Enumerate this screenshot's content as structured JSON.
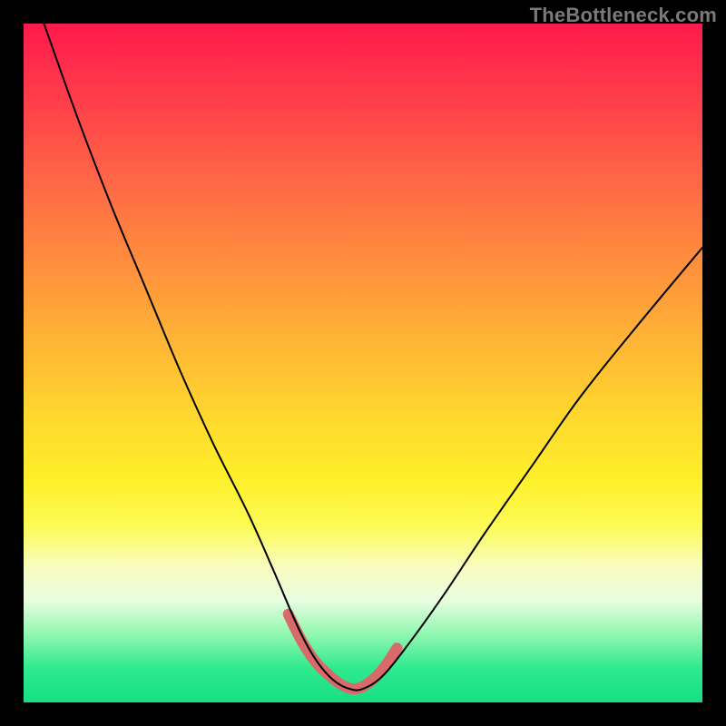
{
  "watermark": "TheBottleneck.com",
  "colors": {
    "gradient_top": "#ff1a4d",
    "gradient_mid": "#ffd82e",
    "gradient_bottom": "#16df84",
    "curve": "#000000",
    "highlight": "#d86a6a",
    "frame": "#000000"
  },
  "chart_data": {
    "type": "line",
    "title": "",
    "xlabel": "",
    "ylabel": "",
    "xlim": [
      0,
      100
    ],
    "ylim": [
      0,
      100
    ],
    "grid": false,
    "legend": false,
    "note": "Background is a vertical green→yellow→red gradient indicating bottleneck severity (green=good at bottom, red=bad at top). Single V-shaped curve overlaid; coral highlight marks the optimal (lowest) region of the curve.",
    "series": [
      {
        "name": "bottleneck-curve",
        "x": [
          3,
          8,
          13,
          18,
          23,
          28,
          33,
          37,
          40,
          42,
          44,
          46,
          48,
          50,
          53,
          57,
          62,
          68,
          75,
          82,
          90,
          100
        ],
        "y": [
          100,
          86,
          73,
          61,
          49,
          38,
          28,
          19,
          12,
          8,
          5,
          3,
          2,
          2,
          4,
          9,
          16,
          25,
          35,
          45,
          55,
          67
        ]
      }
    ],
    "highlight_region": {
      "description": "coral thick stroke over curve minimum",
      "x": [
        39,
        41,
        43,
        45,
        47,
        49,
        51,
        53,
        55
      ],
      "y": [
        13,
        9,
        6,
        4,
        2.5,
        2,
        3,
        5,
        8
      ]
    }
  }
}
